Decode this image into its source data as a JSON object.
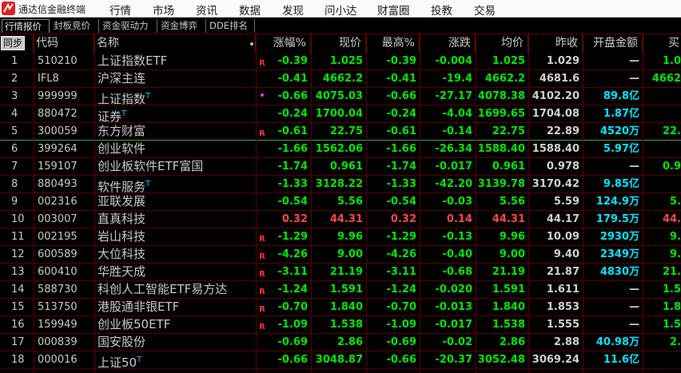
{
  "app": {
    "title": "通达信金融终端"
  },
  "menu": [
    "行情",
    "市场",
    "资讯",
    "数据",
    "发现",
    "问小达",
    "财富圈",
    "投教",
    "交易"
  ],
  "tabs": [
    "行情报价",
    "封板竞价",
    "资金驱动力",
    "资金博弈",
    "DDE排名"
  ],
  "header": {
    "sync": "同步",
    "code": "代码",
    "name": "名称",
    "chg_pct": "涨幅%",
    "price": "现价",
    "high_pct": "最高%",
    "diff": "涨跌",
    "avg": "均价",
    "prev_close": "昨收",
    "open_amount": "开盘金额",
    "buy": "买"
  },
  "colors": {
    "up": "#ff4545",
    "down": "#00e600",
    "neutral": "#e0e0e0",
    "amount": "#00e5ff"
  },
  "rows": [
    {
      "idx": "1",
      "code": "510210",
      "name": "上证指数ETF",
      "sup": "",
      "mark": "R",
      "chg": "-0.39",
      "price": "1.025",
      "high": "-0.39",
      "diff": "-0.004",
      "avg": "1.025",
      "prev": "1.029",
      "open": "—",
      "buy": "1.0",
      "dir": "down"
    },
    {
      "idx": "2",
      "code": "IFL8",
      "name": "沪深主连",
      "sup": "",
      "mark": "",
      "chg": "-0.41",
      "price": "4662.2",
      "high": "-0.41",
      "diff": "-19.4",
      "avg": "4662.2",
      "prev": "4681.6",
      "open": "—",
      "buy": "4662",
      "dir": "down"
    },
    {
      "idx": "3",
      "code": "999999",
      "name": "上证指数",
      "sup": "T",
      "mark": "•",
      "chg": "-0.66",
      "price": "4075.03",
      "high": "-0.66",
      "diff": "-27.17",
      "avg": "4078.38",
      "prev": "4102.20",
      "open": "89.8亿",
      "buy": "",
      "dir": "down"
    },
    {
      "idx": "4",
      "code": "880472",
      "name": "证券",
      "sup": "T",
      "mark": "",
      "chg": "-0.24",
      "price": "1700.04",
      "high": "-0.24",
      "diff": "-4.04",
      "avg": "1699.65",
      "prev": "1704.08",
      "open": "1.87亿",
      "buy": "",
      "dir": "down"
    },
    {
      "idx": "5",
      "code": "300059",
      "name": "东方财富",
      "sup": "",
      "mark": "R",
      "chg": "-0.61",
      "price": "22.75",
      "high": "-0.61",
      "diff": "-0.14",
      "avg": "22.75",
      "prev": "22.89",
      "open": "4520万",
      "buy": "22.",
      "dir": "down"
    },
    {
      "idx": "6",
      "code": "399264",
      "name": "创业软件",
      "sup": "",
      "mark": "",
      "chg": "-1.66",
      "price": "1562.06",
      "high": "-1.66",
      "diff": "-26.34",
      "avg": "1588.40",
      "prev": "1588.40",
      "open": "5.97亿",
      "buy": "",
      "dir": "down"
    },
    {
      "idx": "7",
      "code": "159107",
      "name": "创业板软件ETF富国",
      "sup": "",
      "mark": "",
      "chg": "-1.74",
      "price": "0.961",
      "high": "-1.74",
      "diff": "-0.017",
      "avg": "0.961",
      "prev": "0.978",
      "open": "—",
      "buy": "0.9",
      "dir": "down"
    },
    {
      "idx": "8",
      "code": "880493",
      "name": "软件服务",
      "sup": "T",
      "mark": "",
      "chg": "-1.33",
      "price": "3128.22",
      "high": "-1.33",
      "diff": "-42.20",
      "avg": "3139.78",
      "prev": "3170.42",
      "open": "9.85亿",
      "buy": "",
      "dir": "down"
    },
    {
      "idx": "9",
      "code": "002316",
      "name": "亚联发展",
      "sup": "",
      "mark": "",
      "chg": "-0.54",
      "price": "5.56",
      "high": "-0.54",
      "diff": "-0.03",
      "avg": "5.56",
      "prev": "5.59",
      "open": "124.9万",
      "buy": "5.",
      "dir": "down"
    },
    {
      "idx": "10",
      "code": "003007",
      "name": "直真科技",
      "sup": "",
      "mark": "",
      "chg": "0.32",
      "price": "44.31",
      "high": "0.32",
      "diff": "0.14",
      "avg": "44.31",
      "prev": "44.17",
      "open": "179.5万",
      "buy": "44.",
      "dir": "up"
    },
    {
      "idx": "11",
      "code": "002195",
      "name": "岩山科技",
      "sup": "",
      "mark": "R",
      "chg": "-1.29",
      "price": "9.96",
      "high": "-1.29",
      "diff": "-0.13",
      "avg": "9.96",
      "prev": "10.09",
      "open": "2930万",
      "buy": "9.",
      "dir": "down"
    },
    {
      "idx": "12",
      "code": "600589",
      "name": "大位科技",
      "sup": "",
      "mark": "R",
      "chg": "-4.26",
      "price": "9.00",
      "high": "-4.26",
      "diff": "-0.40",
      "avg": "9.00",
      "prev": "9.40",
      "open": "2349万",
      "buy": "9.",
      "dir": "down"
    },
    {
      "idx": "13",
      "code": "600410",
      "name": "华胜天成",
      "sup": "",
      "mark": "R",
      "chg": "-3.11",
      "price": "21.19",
      "high": "-3.11",
      "diff": "-0.68",
      "avg": "21.19",
      "prev": "21.87",
      "open": "4830万",
      "buy": "21.",
      "dir": "down"
    },
    {
      "idx": "14",
      "code": "588730",
      "name": "科创人工智能ETF易方达",
      "sup": "",
      "mark": "R",
      "chg": "-1.24",
      "price": "1.591",
      "high": "-1.24",
      "diff": "-0.020",
      "avg": "1.591",
      "prev": "1.611",
      "open": "—",
      "buy": "1.5",
      "dir": "down"
    },
    {
      "idx": "15",
      "code": "513750",
      "name": "港股通非银ETF",
      "sup": "",
      "mark": "R",
      "chg": "-0.70",
      "price": "1.840",
      "high": "-0.70",
      "diff": "-0.013",
      "avg": "1.840",
      "prev": "1.853",
      "open": "—",
      "buy": "1.8",
      "dir": "down"
    },
    {
      "idx": "16",
      "code": "159949",
      "name": "创业板50ETF",
      "sup": "",
      "mark": "R",
      "chg": "-1.09",
      "price": "1.538",
      "high": "-1.09",
      "diff": "-0.017",
      "avg": "1.538",
      "prev": "1.555",
      "open": "—",
      "buy": "1.5",
      "dir": "down"
    },
    {
      "idx": "17",
      "code": "000839",
      "name": "国安股份",
      "sup": "",
      "mark": "",
      "chg": "-0.69",
      "price": "2.86",
      "high": "-0.69",
      "diff": "-0.02",
      "avg": "2.86",
      "prev": "2.88",
      "open": "40.98万",
      "buy": "2.",
      "dir": "down"
    },
    {
      "idx": "18",
      "code": "000016",
      "name": "上证50",
      "sup": "T",
      "mark": "",
      "chg": "-0.66",
      "price": "3048.87",
      "high": "-0.66",
      "diff": "-20.37",
      "avg": "3052.48",
      "prev": "3069.24",
      "open": "11.6亿",
      "buy": "",
      "dir": "down"
    }
  ]
}
